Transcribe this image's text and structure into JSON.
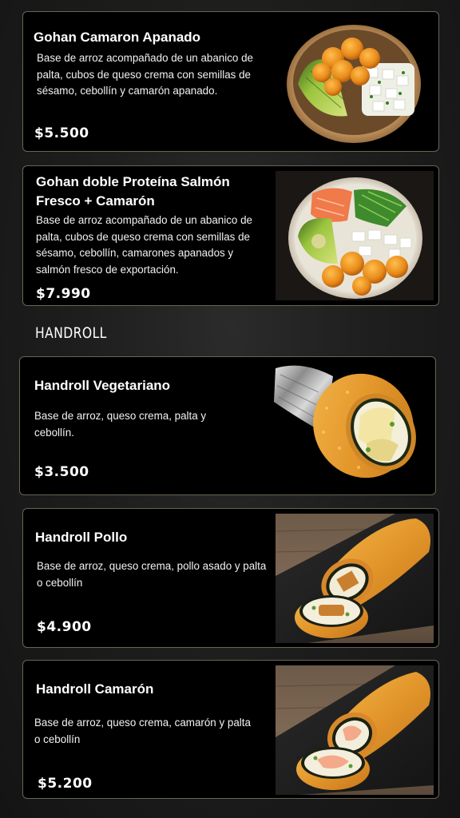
{
  "menu": {
    "items": [
      {
        "title": "Gohan Camaron Apanado",
        "description": "Base de arroz acompañado de un abanico de palta, cubos de queso crema con semillas de sésamo, cebollín y camarón apanado.",
        "price": "$5.500",
        "image": "gohan-bowl-shrimp"
      },
      {
        "title": "Gohan doble Proteína Salmón Fresco + Camarón",
        "description": "Base de arroz acompañado de un abanico de palta, cubos de queso crema con semillas de sésamo, cebollín, camarones apanados y salmón fresco de exportación.",
        "price": "$7.990",
        "image": "gohan-bowl-salmon-shrimp"
      }
    ],
    "handroll_section": {
      "heading": "HANDROLL",
      "items": [
        {
          "title": "Handroll Vegetariano",
          "description": "Base de arroz, queso crema, palta y cebollín.",
          "price": "$3.500",
          "image": "handroll-foil-wrapped"
        },
        {
          "title": "Handroll Pollo",
          "description": "Base de arroz, queso crema, pollo asado y palta o cebollín",
          "price": "$4.900",
          "image": "handroll-on-slate"
        },
        {
          "title": "Handroll Camarón",
          "description": "Base de arroz, queso crema, camarón y palta o cebollín",
          "price": "$5.200",
          "image": "handroll-on-slate"
        }
      ]
    }
  },
  "colors": {
    "background": "#1e1e1e",
    "card": "#000000",
    "card_border": "#6b6355",
    "text": "#ffffff"
  }
}
